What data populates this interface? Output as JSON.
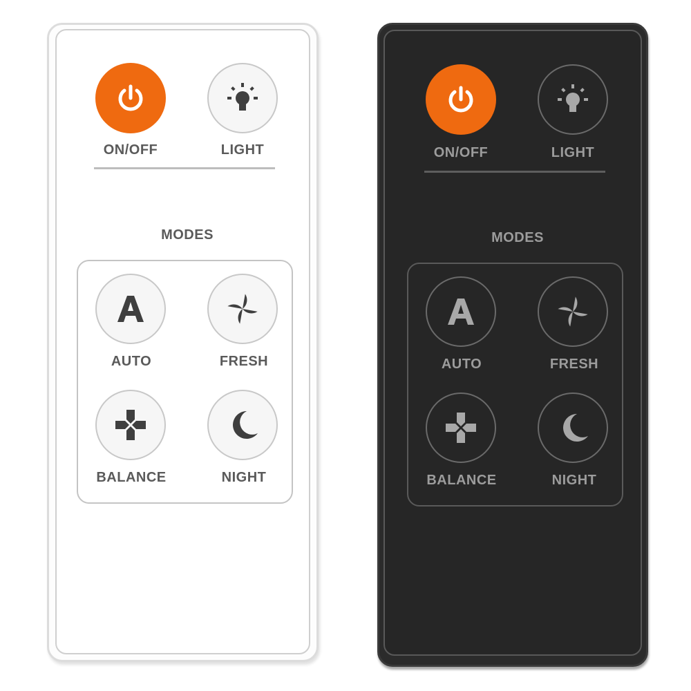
{
  "accent_color": "#ef6a10",
  "remotes": [
    {
      "theme": "light",
      "power": {
        "label": "ON/OFF",
        "icon": "power-icon"
      },
      "light": {
        "label": "LIGHT",
        "icon": "lightbulb-icon"
      },
      "modes_title": "MODES",
      "modes": [
        {
          "label": "AUTO",
          "icon": "letter-a-icon",
          "glyph": "A"
        },
        {
          "label": "FRESH",
          "icon": "fan-icon"
        },
        {
          "label": "BALANCE",
          "icon": "balance-cross-icon"
        },
        {
          "label": "NIGHT",
          "icon": "moon-icon"
        }
      ]
    },
    {
      "theme": "dark",
      "power": {
        "label": "ON/OFF",
        "icon": "power-icon"
      },
      "light": {
        "label": "LIGHT",
        "icon": "lightbulb-icon"
      },
      "modes_title": "MODES",
      "modes": [
        {
          "label": "AUTO",
          "icon": "letter-a-icon",
          "glyph": "A"
        },
        {
          "label": "FRESH",
          "icon": "fan-icon"
        },
        {
          "label": "BALANCE",
          "icon": "balance-cross-icon"
        },
        {
          "label": "NIGHT",
          "icon": "moon-icon"
        }
      ]
    }
  ]
}
